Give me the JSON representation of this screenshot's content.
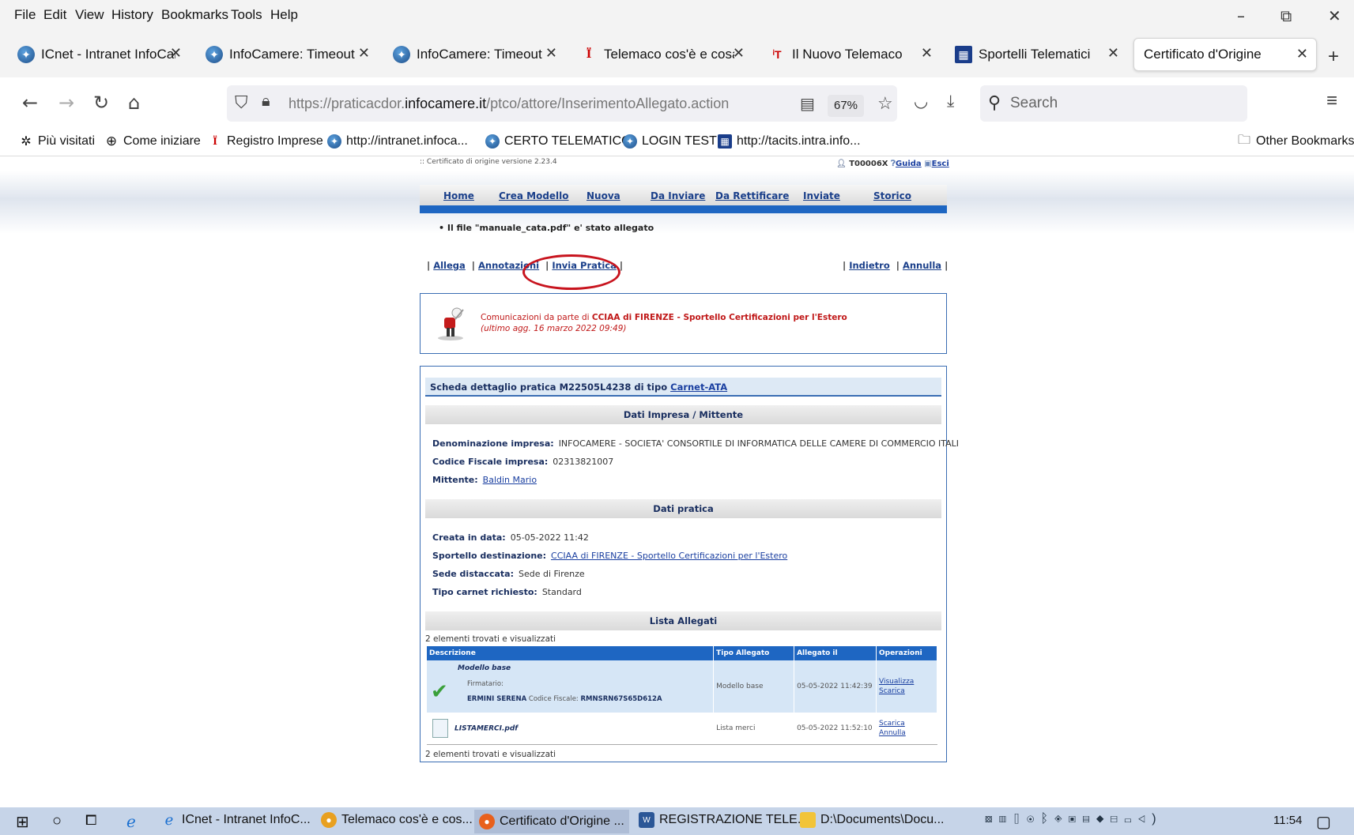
{
  "menu": [
    "File",
    "Edit",
    "View",
    "History",
    "Bookmarks",
    "Tools",
    "Help"
  ],
  "window_controls": {
    "minimize": "–",
    "restore": "⧉",
    "close": "✕"
  },
  "tabs": [
    {
      "title": "ICnet - Intranet InfoCam",
      "icon": "globe-icon"
    },
    {
      "title": "InfoCamere: Timeout",
      "icon": "globe-icon"
    },
    {
      "title": "InfoCamere: Timeout",
      "icon": "globe-icon"
    },
    {
      "title": "Telemaco cos'è e cosa pu",
      "icon": "telemaco-icon"
    },
    {
      "title": "Il Nuovo Telemaco",
      "icon": "telemaco-t-icon"
    },
    {
      "title": "Sportelli Telematici",
      "icon": "sportelli-icon"
    },
    {
      "title": "Certificato d'Origine",
      "icon": "none"
    }
  ],
  "nav": {
    "url_prefix": "https://praticacdor.",
    "url_domain": "infocamere.it",
    "url_path": "/ptco/attore/InserimentoAllegato.action",
    "zoom": "67%",
    "search_placeholder": "Search"
  },
  "bookmarks": [
    {
      "label": "Più visitati",
      "icon": "gear-icon"
    },
    {
      "label": "Come iniziare",
      "icon": "globe-outline-icon"
    },
    {
      "label": "Registro Imprese",
      "icon": "telemaco-icon"
    },
    {
      "label": "http://intranet.infoca...",
      "icon": "globe-icon"
    },
    {
      "label": "CERTO TELEMATICO",
      "icon": "globe-icon"
    },
    {
      "label": "LOGIN TEST",
      "icon": "globe-icon"
    },
    {
      "label": "http://tacits.intra.info...",
      "icon": "sportelli-icon"
    }
  ],
  "other_bookmarks": "Other Bookmarks",
  "page": {
    "version": ":: Certificato di origine versione 2.23.4",
    "user": "T00006X",
    "guida": "Guida",
    "esci": "Esci",
    "mainnav": [
      "Home",
      "Crea Modello",
      "Nuova",
      "Da Inviare",
      "Da Rettificare",
      "Inviate",
      "Storico"
    ],
    "message": "• Il file \"manuale_cata.pdf\" e' stato allegato",
    "actions_left": {
      "allega": "Allega",
      "annotazioni": "Annotazioni",
      "invia": "Invia Pratica"
    },
    "actions_right": {
      "indietro": "Indietro",
      "annulla": "Annulla"
    },
    "notice": {
      "prefix": "Comunicazioni da parte di ",
      "bold": "CCIAA di FIRENZE - Sportello Certificazioni per l'Estero",
      "updated": "(ultimo agg. 16 marzo 2022 09:49)"
    },
    "detail": {
      "title_prefix": "Scheda dettaglio pratica M22505L4238 di tipo ",
      "title_link": "Carnet-ATA",
      "sec_impresa": "Dati Impresa / Mittente",
      "denominazione_label": "Denominazione impresa:",
      "denominazione_value": "INFOCAMERE - SOCIETA' CONSORTILE DI INFORMATICA DELLE CAMERE DI COMMERCIO ITALI",
      "cf_label": "Codice Fiscale impresa:",
      "cf_value": "02313821007",
      "mittente_label": "Mittente:",
      "mittente_value": "Baldin Mario",
      "sec_pratica": "Dati pratica",
      "creata_label": "Creata in data:",
      "creata_value": "05-05-2022 11:42",
      "sportello_label": "Sportello destinazione:",
      "sportello_value": "CCIAA di FIRENZE - Sportello Certificazioni per l'Estero",
      "sede_label": "Sede distaccata:",
      "sede_value": "Sede di Firenze",
      "tipo_label": "Tipo carnet richiesto:",
      "tipo_value": "Standard",
      "sec_allegati": "Lista Allegati",
      "found": "2 elementi trovati e visualizzati",
      "columns": [
        "Descrizione",
        "Tipo Allegato",
        "Allegato il",
        "Operazioni"
      ],
      "row1": {
        "name": "Modello base",
        "firmatario_label": "Firmatario:",
        "firmatario_name": "ERMINI SERENA",
        "cf_label": "Codice Fiscale:",
        "cf_value": "RMNSRN67S65D612A",
        "tipo": "Modello base",
        "date": "05-05-2022 11:42:39",
        "op1": "Visualizza",
        "op2": "Scarica"
      },
      "row2": {
        "name": "LISTAMERCI.pdf",
        "tipo": "Lista merci",
        "date": "05-05-2022 11:52:10",
        "op1": "Scarica",
        "op2": "Annulla"
      }
    }
  },
  "taskbar": {
    "items": [
      "ICnet - Intranet InfoC...",
      "Telemaco cos'è e cos...",
      "Certificato d'Origine ...",
      "REGISTRAZIONE TELE...",
      "D:\\Documents\\Docu..."
    ],
    "clock": "11:54"
  },
  "colors": {
    "accent": "#1e66c2",
    "highlight": "#c8141e",
    "notice_text": "#c01818"
  }
}
